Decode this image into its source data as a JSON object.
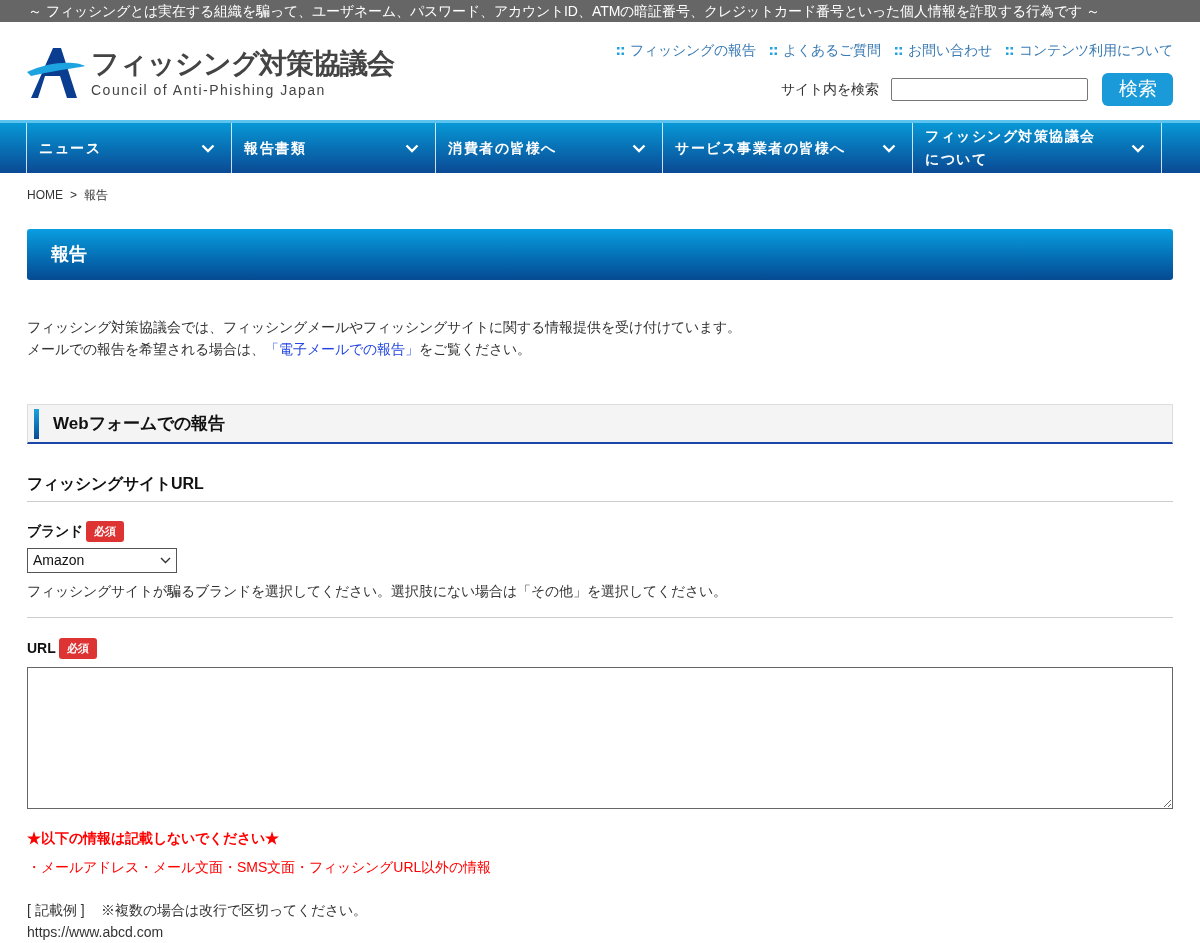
{
  "top_banner": "～ フィッシングとは実在する組織を騙って、ユーザネーム、パスワード、アカウントID、ATMの暗証番号、クレジットカード番号といった個人情報を詐取する行為です ～",
  "logo": {
    "title": "フィッシング対策協議会",
    "subtitle": "Council of Anti-Phishing Japan"
  },
  "header_links": [
    "フィッシングの報告",
    "よくあるご質問",
    "お問い合わせ",
    "コンテンツ利用について"
  ],
  "search": {
    "label": "サイト内を検索",
    "button": "検索"
  },
  "nav": [
    {
      "label": "ニュース"
    },
    {
      "label": "報告書類"
    },
    {
      "label": "消費者の皆様へ"
    },
    {
      "label": "サービス事業者の皆様へ"
    },
    {
      "lines": [
        "フィッシング対策協議会",
        "について"
      ]
    }
  ],
  "breadcrumb": [
    "HOME",
    "報告"
  ],
  "breadcrumb_separator": ">",
  "page_title": "報告",
  "intro": [
    "フィッシング対策協議会では、フィッシングメールやフィッシングサイトに関する情報提供を受け付けています。",
    {
      "before": "メールでの報告を希望される場合は、",
      "link": "「電子メールでの報告」",
      "after": "をご覧ください。"
    }
  ],
  "section_title": "Webフォームでの報告",
  "subsection_title": "フィッシングサイトURL",
  "fields": [
    {
      "kind": "select",
      "label": "ブランド",
      "required": true,
      "badge": "必須",
      "value": "Amazon",
      "help": "フィッシングサイトが騙るブランドを選択してください。選択肢にない場合は「その他」を選択してください。"
    },
    {
      "kind": "textarea",
      "label": "URL",
      "required": true,
      "badge": "必須"
    }
  ],
  "warning": {
    "title": "★以下の情報は記載しないでください★",
    "text": "・メールアドレス・メール文面・SMS文面・フィッシングURL以外の情報"
  },
  "example": {
    "label": "[ 記載例 ]",
    "note": "※複数の場合は改行で区切ってください。",
    "sample": "https://www.abcd.com"
  }
}
